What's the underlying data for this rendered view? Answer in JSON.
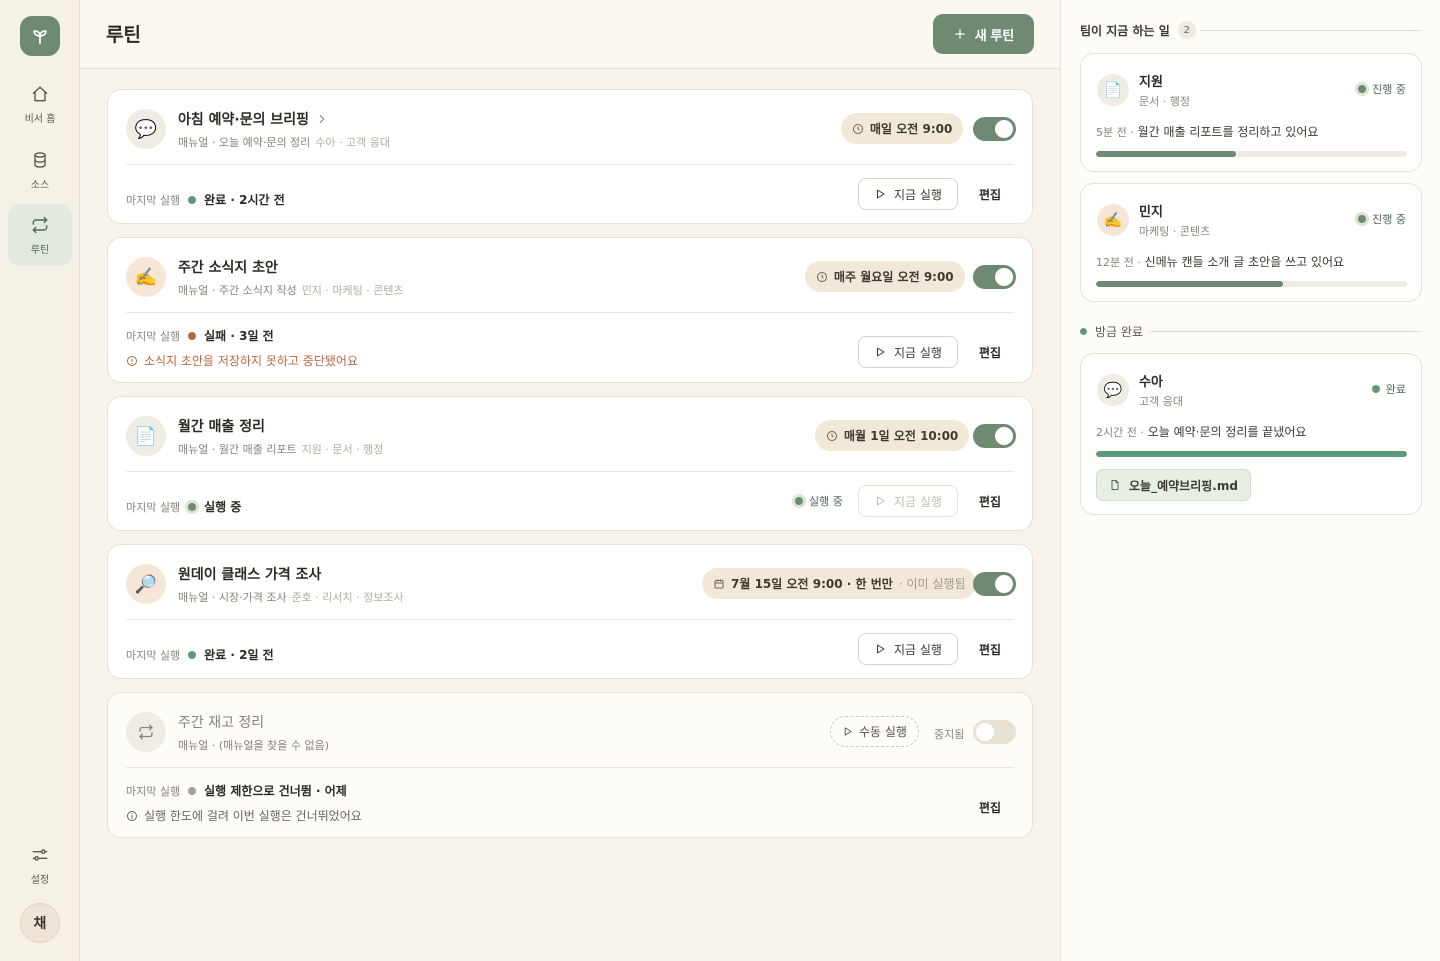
{
  "nav": {
    "items": [
      {
        "label": "비서 홈",
        "icon": "home-icon"
      },
      {
        "label": "소스",
        "icon": "database-icon"
      },
      {
        "label": "루틴",
        "icon": "repeat-icon"
      }
    ],
    "settings_label": "설정",
    "avatar_initial": "채"
  },
  "header": {
    "title": "루틴",
    "new_routine_label": "새 루틴"
  },
  "routines": [
    {
      "title": "아침 예약·문의 브리핑",
      "manual": "매뉴얼 · 오늘 예약·문의 정리",
      "assignee": "수아 · 고객 응대",
      "schedule": "매일 오전 9:00",
      "last_label": "마지막 실행",
      "last_value": "완료 · 2시간 전",
      "run_label": "지금 실행",
      "edit_label": "편집"
    },
    {
      "title": "주간 소식지 초안",
      "manual": "매뉴얼 · 주간 소식지 작성",
      "assignee": "민지 · 마케팅 · 콘텐츠",
      "schedule": "매주 월요일 오전 9:00",
      "last_label": "마지막 실행",
      "last_value": "실패 · 3일 전",
      "error": "소식지 초안을 저장하지 못하고 중단됐어요",
      "run_label": "지금 실행",
      "edit_label": "편집"
    },
    {
      "title": "월간 매출 정리",
      "manual": "매뉴얼 · 월간 매출 리포트",
      "assignee": "지원 · 문서 · 행정",
      "schedule": "매월 1일 오전 10:00",
      "last_label": "마지막 실행",
      "last_value": "실행 중",
      "running_badge": "실행 중",
      "run_label": "지금 실행",
      "edit_label": "편집"
    },
    {
      "title": "원데이 클래스 가격 조사",
      "manual": "매뉴얼 · 시장·가격 조사",
      "assignee": "준호 · 리서치 · 정보조사",
      "schedule": "7월 15일 오전 9:00 · 한 번만",
      "schedule_note": "· 이미 실행됨",
      "last_label": "마지막 실행",
      "last_value": "완료 · 2일 전",
      "run_label": "지금 실행",
      "edit_label": "편집"
    },
    {
      "title": "주간 재고 정리",
      "manual": "매뉴얼 · (매뉴얼을 찾을 수 없음)",
      "schedule": "수동 실행",
      "paused_label": "중지됨",
      "last_label": "마지막 실행",
      "last_value": "실행 제한으로 건너뜀 · 어제",
      "info": "실행 한도에 걸려 이번 실행은 건너뛰었어요",
      "edit_label": "편집"
    }
  ],
  "team": {
    "now_title": "팀이 지금 하는 일",
    "now_count": "2",
    "members": [
      {
        "name": "지원",
        "role": "문서 · 행정",
        "status": "진행 중",
        "ago": "5분 전 ·",
        "message": "월간 매출 리포트를 정리하고 있어요",
        "progress": 0.45
      },
      {
        "name": "민지",
        "role": "마케팅 · 콘텐츠",
        "status": "진행 중",
        "ago": "12분 전 ·",
        "message": "신메뉴 캔들 소개 글 초안을 쓰고 있어요",
        "progress": 0.6
      }
    ],
    "done_title": "방금 완료",
    "done": {
      "name": "수아",
      "role": "고객 응대",
      "status": "완료",
      "ago": "2시간 전 ·",
      "message": "오늘 예약·문의 정리를 끝냈어요",
      "progress": 1.0,
      "file": "오늘_예약브리핑.md"
    }
  },
  "colors": {
    "accent": "#6e8a72",
    "success": "#5d9a76",
    "error": "#b8683f",
    "background": "#f7f3ea"
  }
}
